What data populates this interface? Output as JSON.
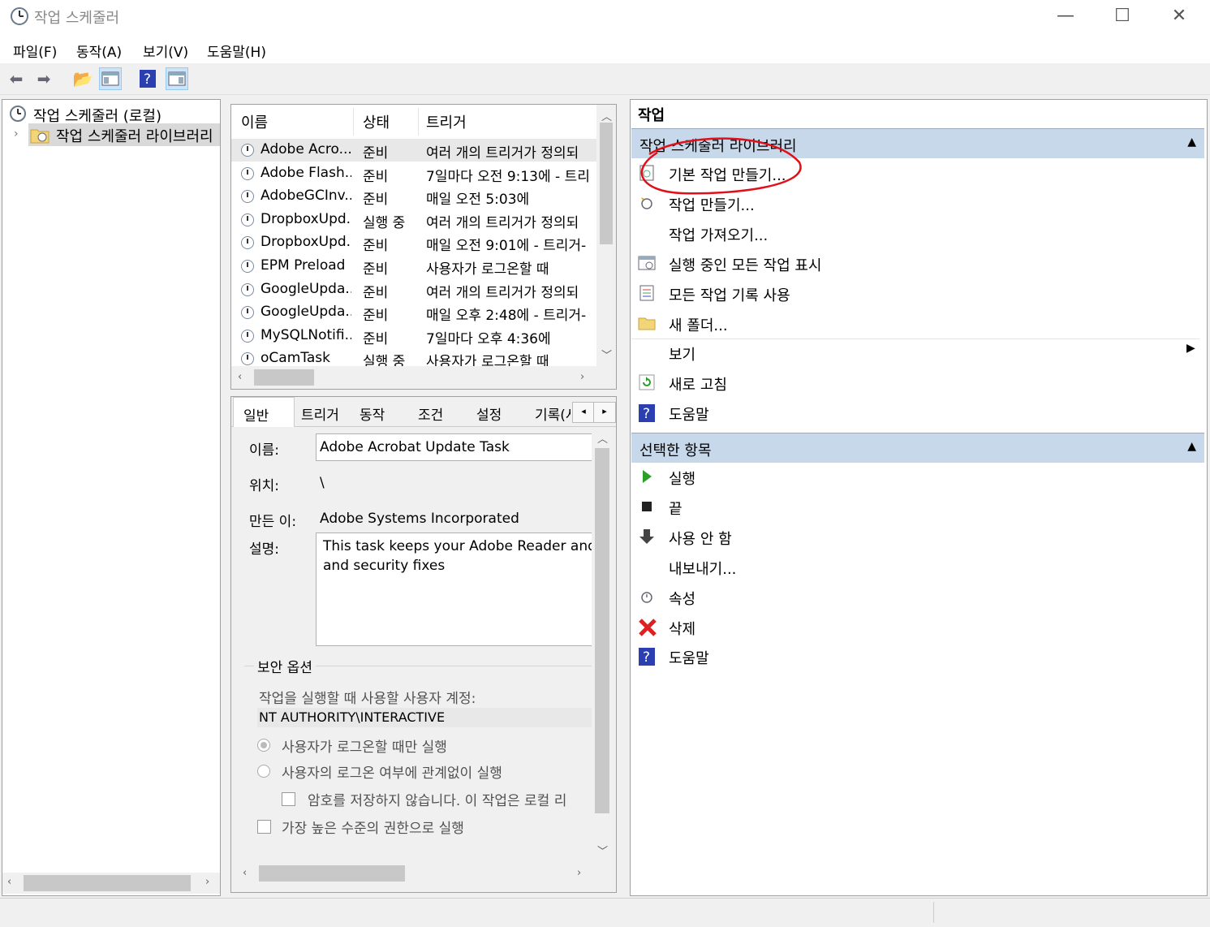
{
  "window": {
    "title": "작업 스케줄러",
    "minimize": "—",
    "maximize": "☐",
    "close": "✕"
  },
  "menu": [
    "파일(F)",
    "동작(A)",
    "보기(V)",
    "도움말(H)"
  ],
  "tree": {
    "root": "작업 스케줄러 (로컬)",
    "child": "작업 스케줄러 라이브러리"
  },
  "task_list": {
    "headers": {
      "name": "이름",
      "status": "상태",
      "trigger": "트리거"
    },
    "rows": [
      {
        "name": "Adobe Acro...",
        "status": "준비",
        "trigger": "여러 개의 트리거가 정의되"
      },
      {
        "name": "Adobe Flash...",
        "status": "준비",
        "trigger": "7일마다 오전 9:13에 - 트리"
      },
      {
        "name": "AdobeGCInv...",
        "status": "준비",
        "trigger": "매일 오전 5:03에"
      },
      {
        "name": "DropboxUpd...",
        "status": "실행 중",
        "trigger": "여러 개의 트리거가 정의되"
      },
      {
        "name": "DropboxUpd...",
        "status": "준비",
        "trigger": "매일 오전 9:01에 - 트리거-"
      },
      {
        "name": "EPM Preload",
        "status": "준비",
        "trigger": "사용자가 로그온할 때"
      },
      {
        "name": "GoogleUpda...",
        "status": "준비",
        "trigger": "여러 개의 트리거가 정의되"
      },
      {
        "name": "GoogleUpda...",
        "status": "준비",
        "trigger": "매일 오후 2:48에 - 트리거-"
      },
      {
        "name": "MySQLNotifi...",
        "status": "준비",
        "trigger": "7일마다 오후 4:36에"
      },
      {
        "name": "oCamTask",
        "status": "실행 중",
        "trigger": "사용자가 로그온할 때"
      }
    ]
  },
  "details": {
    "tabs": [
      "일반",
      "트리거",
      "동작",
      "조건",
      "설정",
      "기록(사"
    ],
    "name_label": "이름:",
    "name_value": "Adobe Acrobat Update Task",
    "location_label": "위치:",
    "location_value": "\\",
    "author_label": "만든 이:",
    "author_value": "Adobe Systems Incorporated",
    "desc_label": "설명:",
    "desc_line1": "This task keeps your Adobe Reader and Acr",
    "desc_line2": "and security fixes",
    "security_title": "보안 옵션",
    "account_label": "작업을 실행할 때 사용할 사용자 계정:",
    "account_value": "NT AUTHORITY\\INTERACTIVE",
    "radio1": "사용자가 로그온할 때만 실행",
    "radio2": "사용자의 로그온 여부에 관계없이 실행",
    "check_nopass": "암호를 저장하지 않습니다. 이 작업은 로컬 리",
    "check_highest": "가장 높은 수준의 권한으로 실행"
  },
  "actions": {
    "header": "작업",
    "section1": "작업 스케줄러 라이브러리",
    "items1": [
      {
        "label": "기본 작업 만들기...",
        "icon": "wizard-icon"
      },
      {
        "label": "작업 만들기...",
        "icon": "new-task-icon"
      },
      {
        "label": "작업 가져오기...",
        "icon": ""
      },
      {
        "label": "실행 중인 모든 작업 표시",
        "icon": "running-tasks-icon"
      },
      {
        "label": "모든 작업 기록 사용",
        "icon": "history-icon"
      },
      {
        "label": "새 폴더...",
        "icon": "folder-icon"
      },
      {
        "label": "보기",
        "icon": ""
      },
      {
        "label": "새로 고침",
        "icon": "refresh-icon"
      },
      {
        "label": "도움말",
        "icon": "help-icon"
      }
    ],
    "section2": "선택한 항목",
    "items2": [
      {
        "label": "실행",
        "icon": "run-icon"
      },
      {
        "label": "끝",
        "icon": "stop-icon"
      },
      {
        "label": "사용 안 함",
        "icon": "disable-icon"
      },
      {
        "label": "내보내기...",
        "icon": ""
      },
      {
        "label": "속성",
        "icon": "properties-icon"
      },
      {
        "label": "삭제",
        "icon": "delete-icon"
      },
      {
        "label": "도움말",
        "icon": "help-icon"
      }
    ]
  },
  "colors": {
    "section_bg": "#c7d8ea",
    "annotation": "#e0101a"
  }
}
